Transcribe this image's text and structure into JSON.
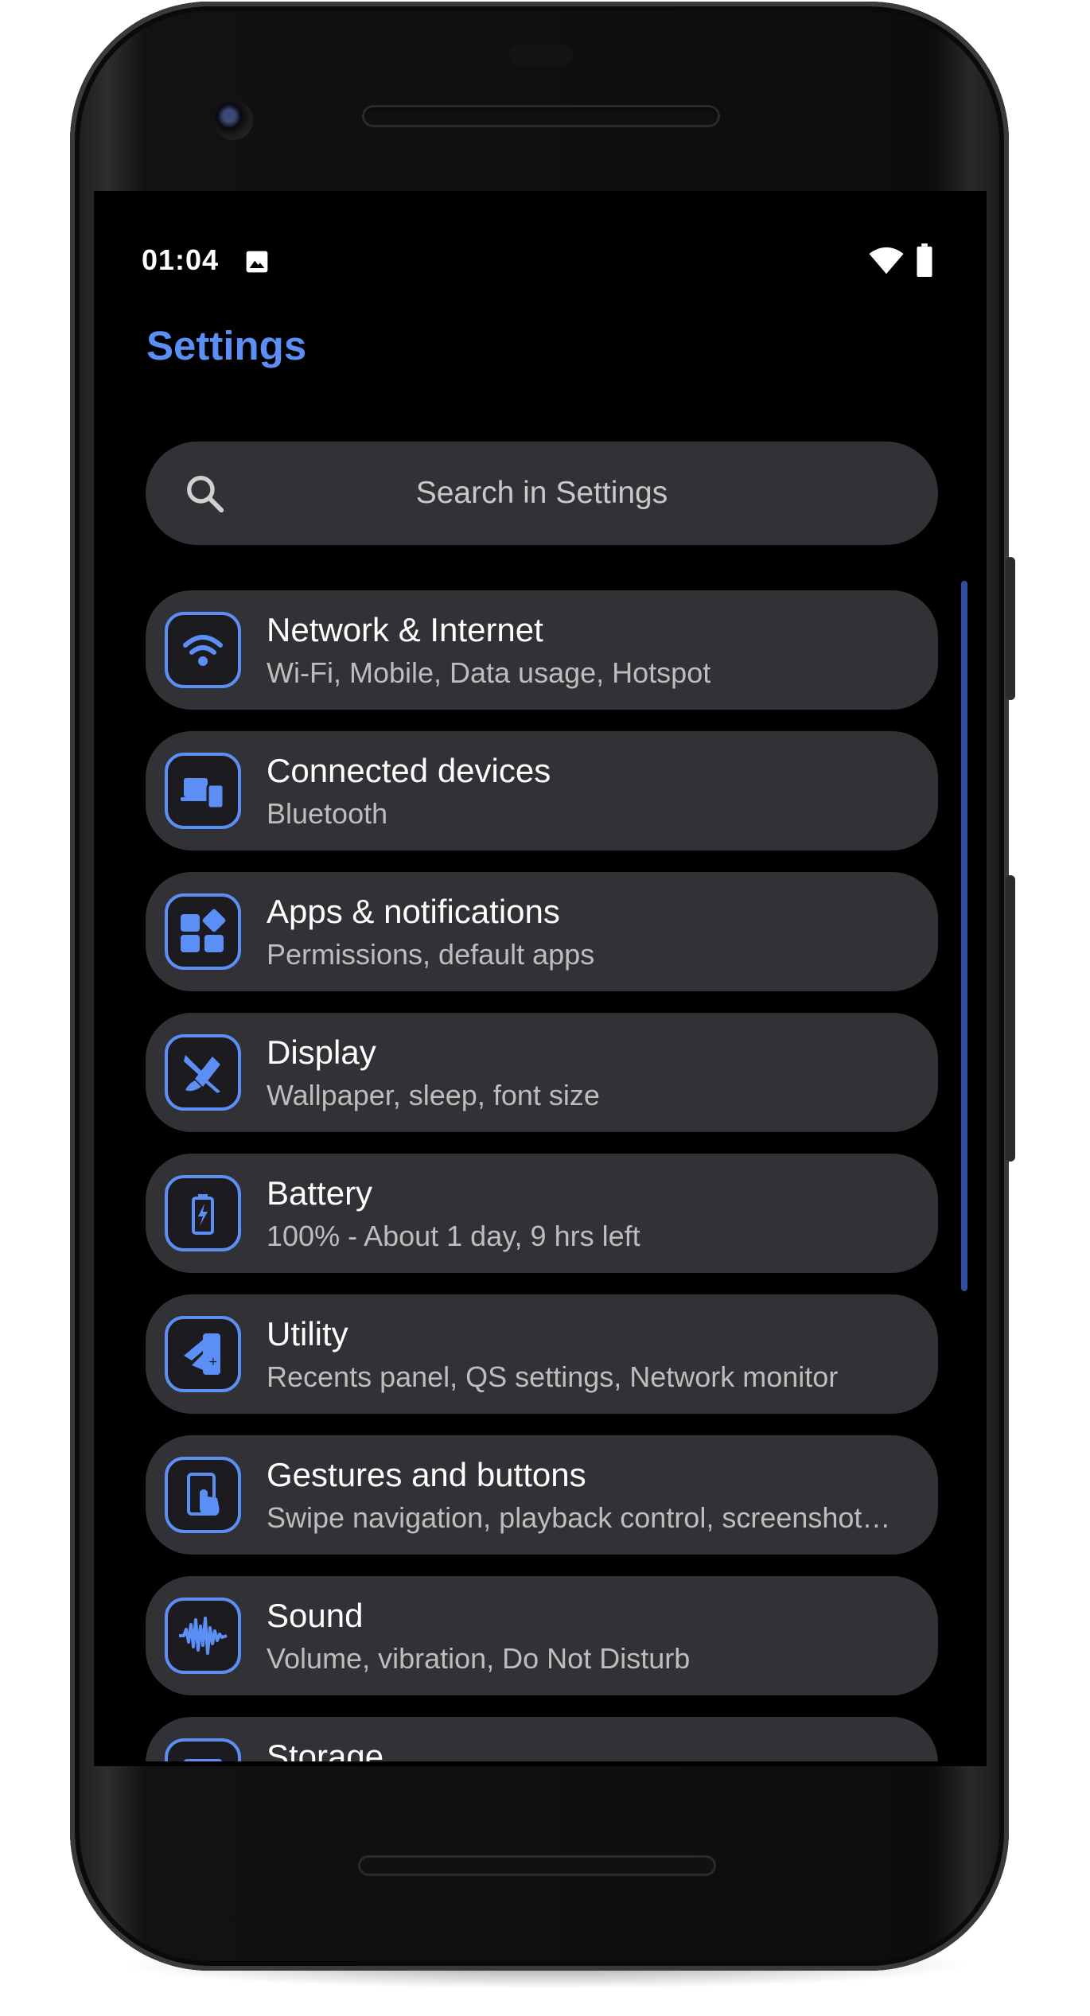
{
  "status_bar": {
    "time": "01:04"
  },
  "header": {
    "title": "Settings"
  },
  "search": {
    "placeholder": "Search in Settings"
  },
  "colors": {
    "accent": "#5c8ff5",
    "card": "#323236",
    "background": "#000000"
  },
  "items": [
    {
      "icon": "wifi-icon",
      "title": "Network & Internet",
      "subtitle": "Wi-Fi, Mobile, Data usage, Hotspot"
    },
    {
      "icon": "devices-icon",
      "title": "Connected devices",
      "subtitle": "Bluetooth"
    },
    {
      "icon": "apps-icon",
      "title": "Apps & notifications",
      "subtitle": "Permissions, default apps"
    },
    {
      "icon": "brush-icon",
      "title": "Display",
      "subtitle": "Wallpaper, sleep, font size"
    },
    {
      "icon": "battery-icon",
      "title": "Battery",
      "subtitle": "100% - About 1 day, 9 hrs left"
    },
    {
      "icon": "utility-icon",
      "title": "Utility",
      "subtitle": "Recents panel, QS settings, Network monitor"
    },
    {
      "icon": "gesture-icon",
      "title": "Gestures and buttons",
      "subtitle": "Swipe navigation, playback control, screenshot…"
    },
    {
      "icon": "sound-wave-icon",
      "title": "Sound",
      "subtitle": "Volume, vibration, Do Not Disturb"
    },
    {
      "icon": "storage-icon",
      "title": "Storage",
      "subtitle": ""
    }
  ]
}
